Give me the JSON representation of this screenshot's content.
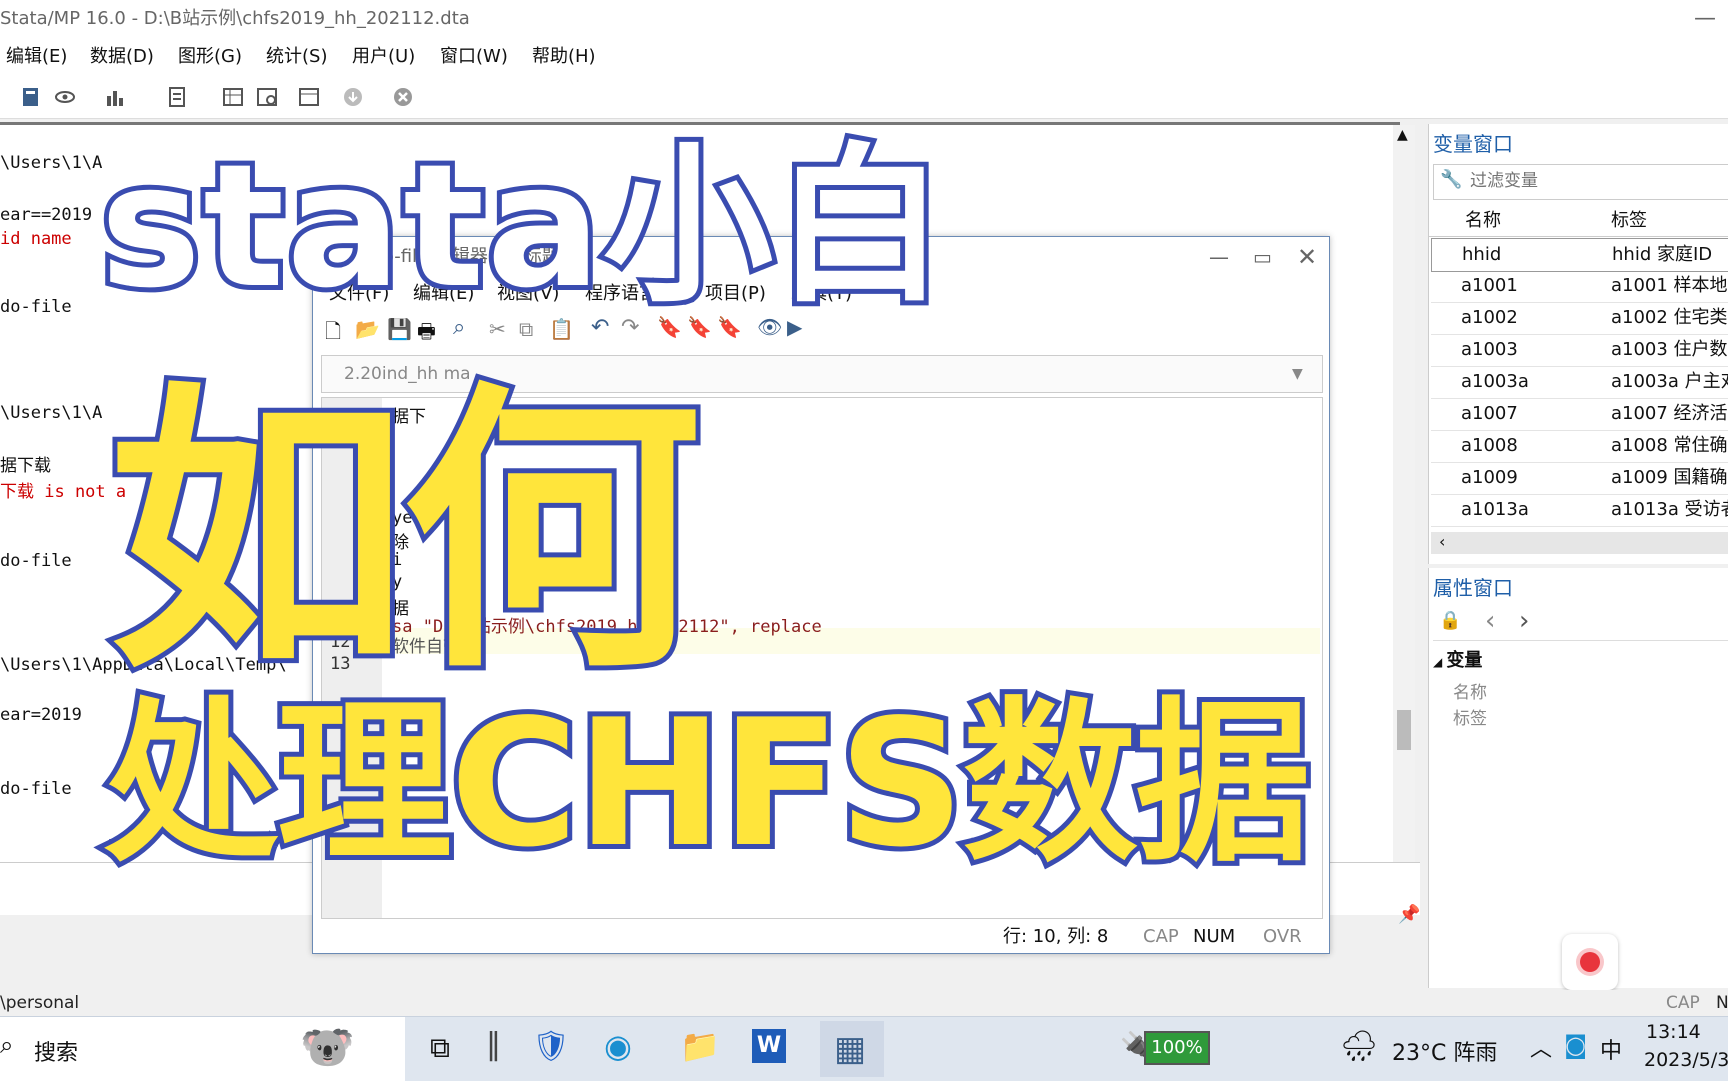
{
  "window": {
    "title": "Stata/MP 16.0 - D:\\B站示例\\chfs2019_hh_202112.dta"
  },
  "menu": [
    "编辑(E)",
    "数据(D)",
    "图形(G)",
    "统计(S)",
    "用户(U)",
    "窗口(W)",
    "帮助(H)"
  ],
  "results": {
    "lines": [
      {
        "text": "\\Users\\1\\A",
        "red": false
      },
      {
        "text": "ear==2019",
        "red": false
      },
      {
        "text": "id name",
        "red": true
      },
      {
        "text": "do-file",
        "red": false
      },
      {
        "text": "\\Users\\1\\A",
        "red": false
      },
      {
        "text": "据下载",
        "red": false
      },
      {
        "text": "下载 is not a",
        "red": true
      },
      {
        "text": "do-file",
        "red": false
      },
      {
        "text": "\\Users\\1\\AppData\\Local\\Temp\\",
        "red": false
      },
      {
        "text": "ear=2019",
        "red": false
      },
      {
        "text": "do-file",
        "red": false
      }
    ]
  },
  "statusbar": {
    "path": "\\personal",
    "cap": "CAP",
    "num": "N"
  },
  "variables": {
    "title": "变量窗口",
    "filter_placeholder": "过滤变量",
    "col_name": "名称",
    "col_label": "标签",
    "rows": [
      {
        "name": "hhid",
        "label": "hhid 家庭ID"
      },
      {
        "name": "a1001",
        "label": "a1001 样本地址"
      },
      {
        "name": "a1002",
        "label": "a1002 住宅类型"
      },
      {
        "name": "a1003",
        "label": "a1003 住户数量"
      },
      {
        "name": "a1003a",
        "label": "a1003a 户主对"
      },
      {
        "name": "a1007",
        "label": "a1007 经济活动"
      },
      {
        "name": "a1008",
        "label": "a1008 常住确认"
      },
      {
        "name": "a1009",
        "label": "a1009 国籍确认"
      },
      {
        "name": "a1013a",
        "label": "a1013a 受访者"
      }
    ]
  },
  "properties": {
    "title": "属性窗口",
    "section": "变量",
    "field_name": "名称",
    "field_label": "标签"
  },
  "dofile": {
    "title": "Do-file 编辑器 - 无标题.do",
    "menu": [
      "文件(F)",
      "编辑(E)",
      "视图(V)",
      "程序语言(L)",
      "项目(P)",
      "工具(T)"
    ],
    "tab": "2.20ind_hh ma",
    "line12_no": "12",
    "line13_no": "13",
    "code_line11": "sa \"D:\\B站示例\\chfs2019_hh_202112\", replace",
    "code_line12": "软件自带",
    "code_frag1": "据下",
    "code_frag2": "ye",
    "code_frag3": "除",
    "code_frag4": "i",
    "code_frag5": "y",
    "code_frag6": "据",
    "status_pos": "行: 10, 列: 8",
    "status_cap": "CAP",
    "status_num": "NUM",
    "status_ovr": "OVR"
  },
  "overlay": {
    "line1": "stata小白",
    "line2": "如何",
    "line3": "处理CHFS数据"
  },
  "taskbar": {
    "search": "搜索",
    "battery": "100%",
    "weather": "23°C 阵雨",
    "ime": "中",
    "time": "13:14",
    "date": "2023/5/3"
  }
}
